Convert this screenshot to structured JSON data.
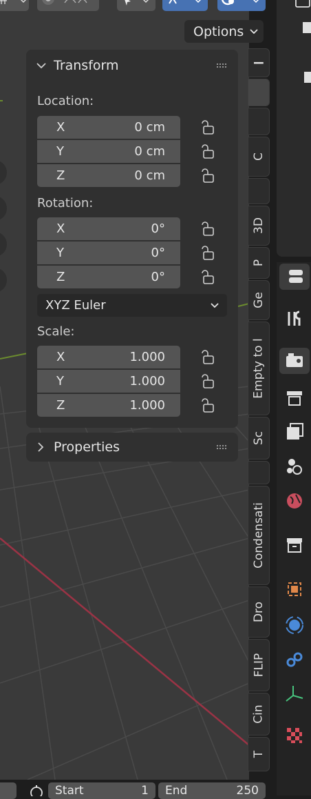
{
  "options": {
    "label": "Options"
  },
  "transform": {
    "title": "Transform",
    "location": {
      "label": "Location:",
      "fields": [
        {
          "axis": "X",
          "value": "0 cm"
        },
        {
          "axis": "Y",
          "value": "0 cm"
        },
        {
          "axis": "Z",
          "value": "0 cm"
        }
      ]
    },
    "rotation": {
      "label": "Rotation:",
      "fields": [
        {
          "axis": "X",
          "value": "0°"
        },
        {
          "axis": "Y",
          "value": "0°"
        },
        {
          "axis": "Z",
          "value": "0°"
        }
      ]
    },
    "rotation_mode": "XYZ Euler",
    "scale": {
      "label": "Scale:",
      "fields": [
        {
          "axis": "X",
          "value": "1.000"
        },
        {
          "axis": "Y",
          "value": "1.000"
        },
        {
          "axis": "Z",
          "value": "1.000"
        }
      ]
    }
  },
  "properties_panel": {
    "title": "Properties"
  },
  "sidebar_tabs": [
    "C",
    "3D",
    "P",
    "Ge",
    "Empty to l",
    "Sc",
    "Condensati",
    "Dro",
    "FLIP",
    "Cin",
    "T"
  ],
  "timeline": {
    "start_label": "Start",
    "start_value": "1",
    "end_label": "End",
    "end_value": "250"
  },
  "colors": {
    "accent": "#4772b3",
    "field": "#545454",
    "panel": "#303030",
    "viewport": "#3a3a3a"
  },
  "icons": [
    "tool-icon",
    "render-icon",
    "output-icon",
    "view-layer-icon",
    "scene-icon",
    "world-icon",
    "collection-icon",
    "object-icon",
    "physics-icon",
    "constraints-icon",
    "object-data-icon",
    "texture-icon"
  ]
}
